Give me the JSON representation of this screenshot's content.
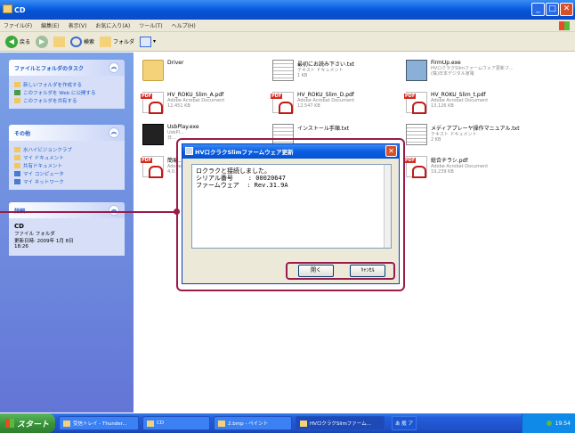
{
  "window": {
    "title": "CD",
    "min": "_",
    "max": "□",
    "close": "✕"
  },
  "menu": [
    "ファイル(F)",
    "編集(E)",
    "表示(V)",
    "お気に入り(A)",
    "ツール(T)",
    "ヘルプ(H)"
  ],
  "toolbar": {
    "back": "戻る",
    "search": "検索",
    "folders": "フォルダ"
  },
  "taskpane": {
    "file_tasks": {
      "title": "ファイルとフォルダのタスク",
      "items": [
        "新しいフォルダを作成する",
        "このフォルダを Web に公開する",
        "このフォルダを共有する"
      ]
    },
    "other": {
      "title": "その他",
      "items": [
        "水ハイビジョンクラブ",
        "マイ ドキュメント",
        "共有ドキュメント",
        "マイ コンピュータ",
        "マイ ネットワーク"
      ]
    },
    "details": {
      "title": "詳細",
      "name": "CD",
      "type": "ファイル フォルダ",
      "modified": "更新日時: 2009年 1月 8日 ",
      "time": "18:26"
    }
  },
  "files": [
    {
      "name": "Driver",
      "sub1": "",
      "sub2": "",
      "icon": "folder"
    },
    {
      "name": "最初にお読み下さい.txt",
      "sub1": "テキスト ドキュメント",
      "sub2": "1 KB",
      "icon": "txt"
    },
    {
      "name": "FirmUp.exe",
      "sub1": "HVロクラクSlimファームウェア更新フ...",
      "sub2": "(株)日本デジタル家電",
      "icon": "exe"
    },
    {
      "name": "HV_ROKU_Slim_A.pdf",
      "sub1": "Adobe Acrobat Document",
      "sub2": "12,451 KB",
      "icon": "pdf"
    },
    {
      "name": "HV_ROKU_Slim_D.pdf",
      "sub1": "Adobe Acrobat Document",
      "sub2": "12,547 KB",
      "icon": "pdf"
    },
    {
      "name": "HV_ROKU_Slim_t.pdf",
      "sub1": "Adobe Acrobat Document",
      "sub2": "13,126 KB",
      "icon": "pdf"
    },
    {
      "name": "UsbPlay.exe",
      "sub1": "UsbPl...",
      "sub2": "日...",
      "icon": "movie"
    },
    {
      "name": "インストール手順.txt",
      "sub1": "",
      "sub2": "",
      "icon": "txt"
    },
    {
      "name": "メディアプレーヤ操作マニュアル.txt",
      "sub1": "テキスト ドキュメント",
      "sub2": "2 KB",
      "icon": "txt"
    },
    {
      "name": "簡易...",
      "sub1": "Adobe...",
      "sub2": "4,0...",
      "icon": "pdf"
    },
    {
      "name": "総合チラシ.pdf",
      "sub1": "Adobe Acrobat Document",
      "sub2": "19,239 KB",
      "icon": "pdf"
    }
  ],
  "dialog": {
    "title": "HVロクラクSlimファームウェア更新",
    "close": "✕",
    "lines": [
      "ロクラクと接続しました。",
      "シリアル番号    : 00020647",
      "ファームウェア  : Rev.31.9A"
    ],
    "btn_ok": "開く",
    "btn_cancel": "ｷｬﾝｾﾙ"
  },
  "taskbar": {
    "start": "スタート",
    "tasks": [
      "受信トレイ - Thunder...",
      "CD",
      "2.bmp - ペイント",
      "HVロクラクSlimファーム..."
    ],
    "lang": "あ 般 ア",
    "clock": "19:54"
  }
}
